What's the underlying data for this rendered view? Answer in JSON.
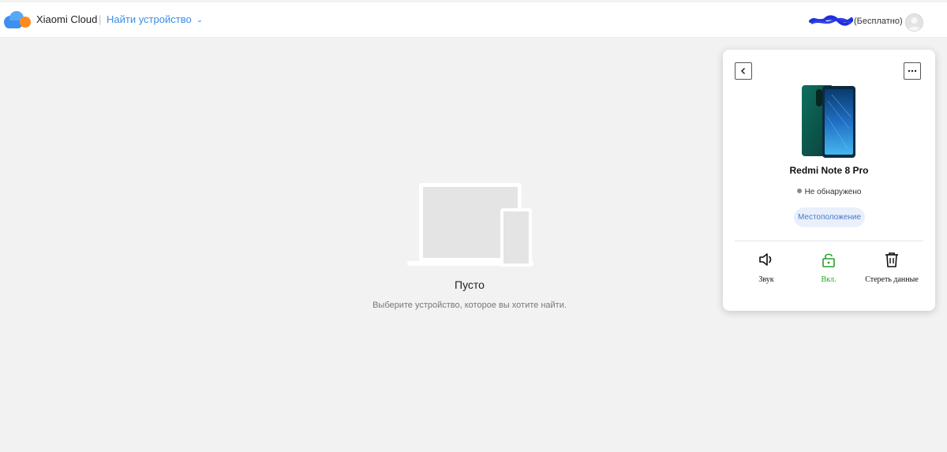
{
  "header": {
    "brand": "Xiaomi Cloud",
    "separator": "|",
    "find_device": "Найти устройство",
    "plan": "(Бесплатно)",
    "icons": {
      "logo": "xiaomi-cloud-logo",
      "dropdown": "chevron-down-icon",
      "avatar": "user-avatar-icon"
    }
  },
  "empty_state": {
    "title": "Пусто",
    "subtitle": "Выберите устройство, которое вы хотите найти."
  },
  "device_card": {
    "device_name": "Redmi Note 8 Pro",
    "status": "Не обнаружено",
    "location_button": "Местоположение",
    "actions": [
      {
        "label": "Звук",
        "icon": "speaker-icon"
      },
      {
        "label": "Вкл.",
        "icon": "unlock-icon"
      },
      {
        "label": "Стереть данные",
        "icon": "trash-icon"
      }
    ]
  },
  "colors": {
    "accent": "#3a8ee6",
    "lock_green": "#2aa02a",
    "location_bg": "#e9f0fc",
    "page_bg": "#f2f2f2"
  }
}
